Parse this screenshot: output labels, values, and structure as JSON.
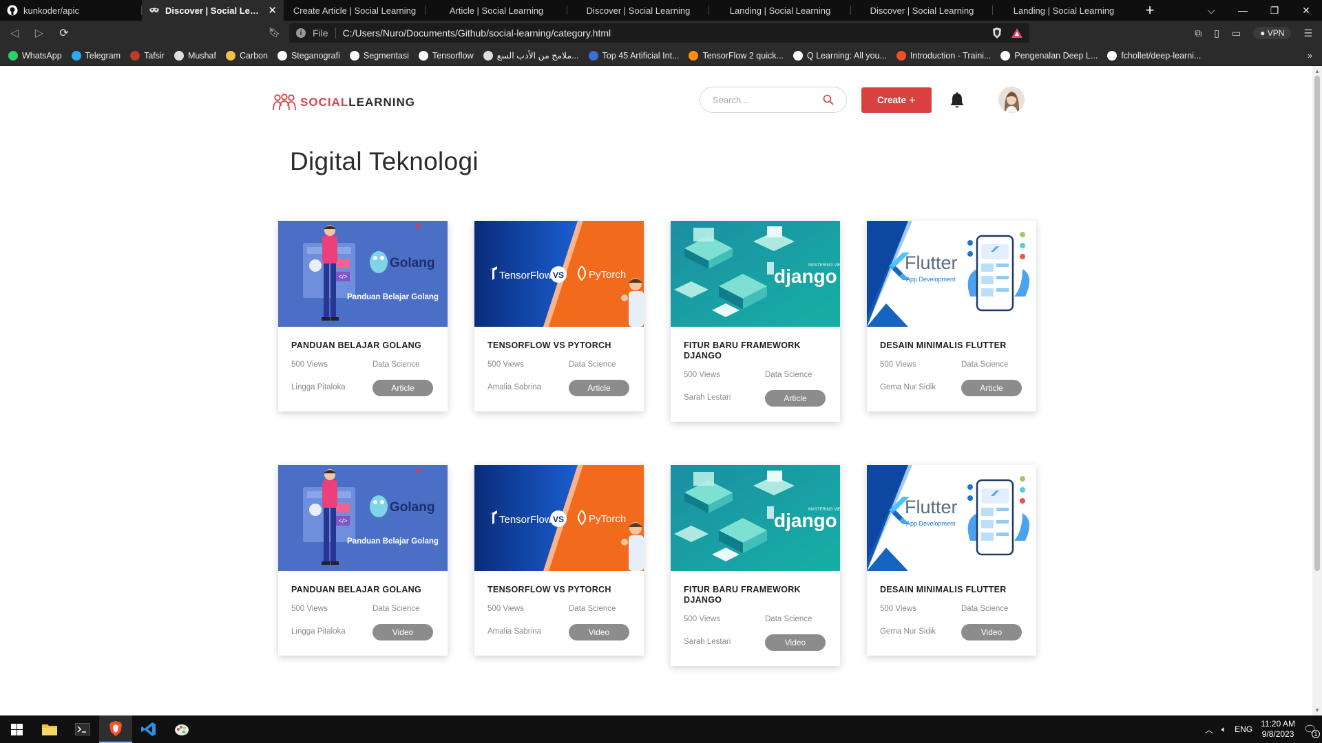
{
  "browser": {
    "tabs": [
      {
        "title": "kunkoder/apic",
        "icon": "github-icon",
        "active": false
      },
      {
        "title": "Discover | Social Learning",
        "icon": "mask-icon",
        "active": true
      },
      {
        "title": "Create Article | Social Learning",
        "active": false
      },
      {
        "title": "Article | Social Learning",
        "active": false
      },
      {
        "title": "Discover | Social Learning",
        "active": false
      },
      {
        "title": "Landing | Social Learning",
        "active": false
      },
      {
        "title": "Discover | Social Learning",
        "active": false
      },
      {
        "title": "Landing | Social Learning",
        "active": false
      }
    ],
    "address": {
      "scheme_label": "File",
      "url": "C:/Users/Nuro/Documents/Github/social-learning/category.html"
    },
    "vpn_label": "VPN",
    "bookmarks": [
      {
        "label": "WhatsApp",
        "color": "#25D366"
      },
      {
        "label": "Telegram",
        "color": "#2AABEE"
      },
      {
        "label": "Tafsir",
        "color": "#c0392b"
      },
      {
        "label": "Mushaf",
        "color": "#dddddd"
      },
      {
        "label": "Carbon",
        "color": "#f0c040"
      },
      {
        "label": "Steganografi",
        "color": "#ffffff"
      },
      {
        "label": "Segmentasi",
        "color": "#ffffff"
      },
      {
        "label": "Tensorflow",
        "color": "#ffffff"
      },
      {
        "label": "ملامح من الأدب السع...",
        "color": "#dddddd"
      },
      {
        "label": "Top 45 Artificial Int...",
        "color": "#3b6fd8"
      },
      {
        "label": "TensorFlow 2 quick...",
        "color": "#FF8F00"
      },
      {
        "label": "Q Learning: All you...",
        "color": "#ffffff"
      },
      {
        "label": "Introduction - Traini...",
        "color": "#f25022"
      },
      {
        "label": "Pengenalan Deep L...",
        "color": "#ffffff"
      },
      {
        "label": "fchollet/deep-learni...",
        "color": "#ffffff"
      }
    ]
  },
  "header": {
    "logo_social": "SOCIAL",
    "logo_learning": "LEARNING",
    "search_placeholder": "Search...",
    "create_label": "Create"
  },
  "page": {
    "title": "Digital Teknologi"
  },
  "cards": [
    {
      "thumb": "golang",
      "thumb_text": "Golang",
      "thumb_sub": "Panduan Belajar Golang",
      "title": "PANDUAN BELAJAR GOLANG",
      "views": "500 Views",
      "category": "Data Science",
      "author": "Lingga Pitaloka",
      "type": "Article"
    },
    {
      "thumb": "tfpt",
      "thumb_text": "TensorFlow",
      "thumb_sub": "PyTorch",
      "title": "TENSORFLOW VS PYTORCH",
      "views": "500 Views",
      "category": "Data Science",
      "author": "Amalia Sabrina",
      "type": "Article"
    },
    {
      "thumb": "django",
      "thumb_text": "django",
      "thumb_sub": "MASTERING VIEWS IN",
      "title": "FITUR BARU FRAMEWORK DJANGO",
      "views": "500 Views",
      "category": "Data Science",
      "author": "Sarah Lestari",
      "type": "Article"
    },
    {
      "thumb": "flutter",
      "thumb_text": "Flutter",
      "thumb_sub": "App Development",
      "title": "DESAIN MINIMALIS FLUTTER",
      "views": "500 Views",
      "category": "Data Science",
      "author": "Gema Nur Sidik",
      "type": "Article"
    },
    {
      "thumb": "golang",
      "thumb_text": "Golang",
      "thumb_sub": "Panduan Belajar Golang",
      "title": "PANDUAN BELAJAR GOLANG",
      "views": "500 Views",
      "category": "Data Science",
      "author": "Lingga Pitaloka",
      "type": "Video"
    },
    {
      "thumb": "tfpt",
      "thumb_text": "TensorFlow",
      "thumb_sub": "PyTorch",
      "title": "TENSORFLOW VS PYTORCH",
      "views": "500 Views",
      "category": "Data Science",
      "author": "Amalia Sabrina",
      "type": "Video"
    },
    {
      "thumb": "django",
      "thumb_text": "django",
      "thumb_sub": "MASTERING VIEWS IN",
      "title": "FITUR BARU FRAMEWORK DJANGO",
      "views": "500 Views",
      "category": "Data Science",
      "author": "Sarah Lestari",
      "type": "Video"
    },
    {
      "thumb": "flutter",
      "thumb_text": "Flutter",
      "thumb_sub": "App Development",
      "title": "DESAIN MINIMALIS FLUTTER",
      "views": "500 Views",
      "category": "Data Science",
      "author": "Gema Nur Sidik",
      "type": "Video"
    }
  ],
  "taskbar": {
    "language": "ENG",
    "time": "11:20 AM",
    "date": "9/8/2023",
    "notification_count": "1"
  },
  "colors": {
    "brand_red": "#d94040",
    "button_gray": "#8c8c8c",
    "golang_bg": "#4b6fc5",
    "tensorflow_blue": "#0a3f9e",
    "pytorch_orange": "#f26a1b",
    "django_teal": "#15a5a8",
    "flutter_blue": "#1565c0"
  }
}
